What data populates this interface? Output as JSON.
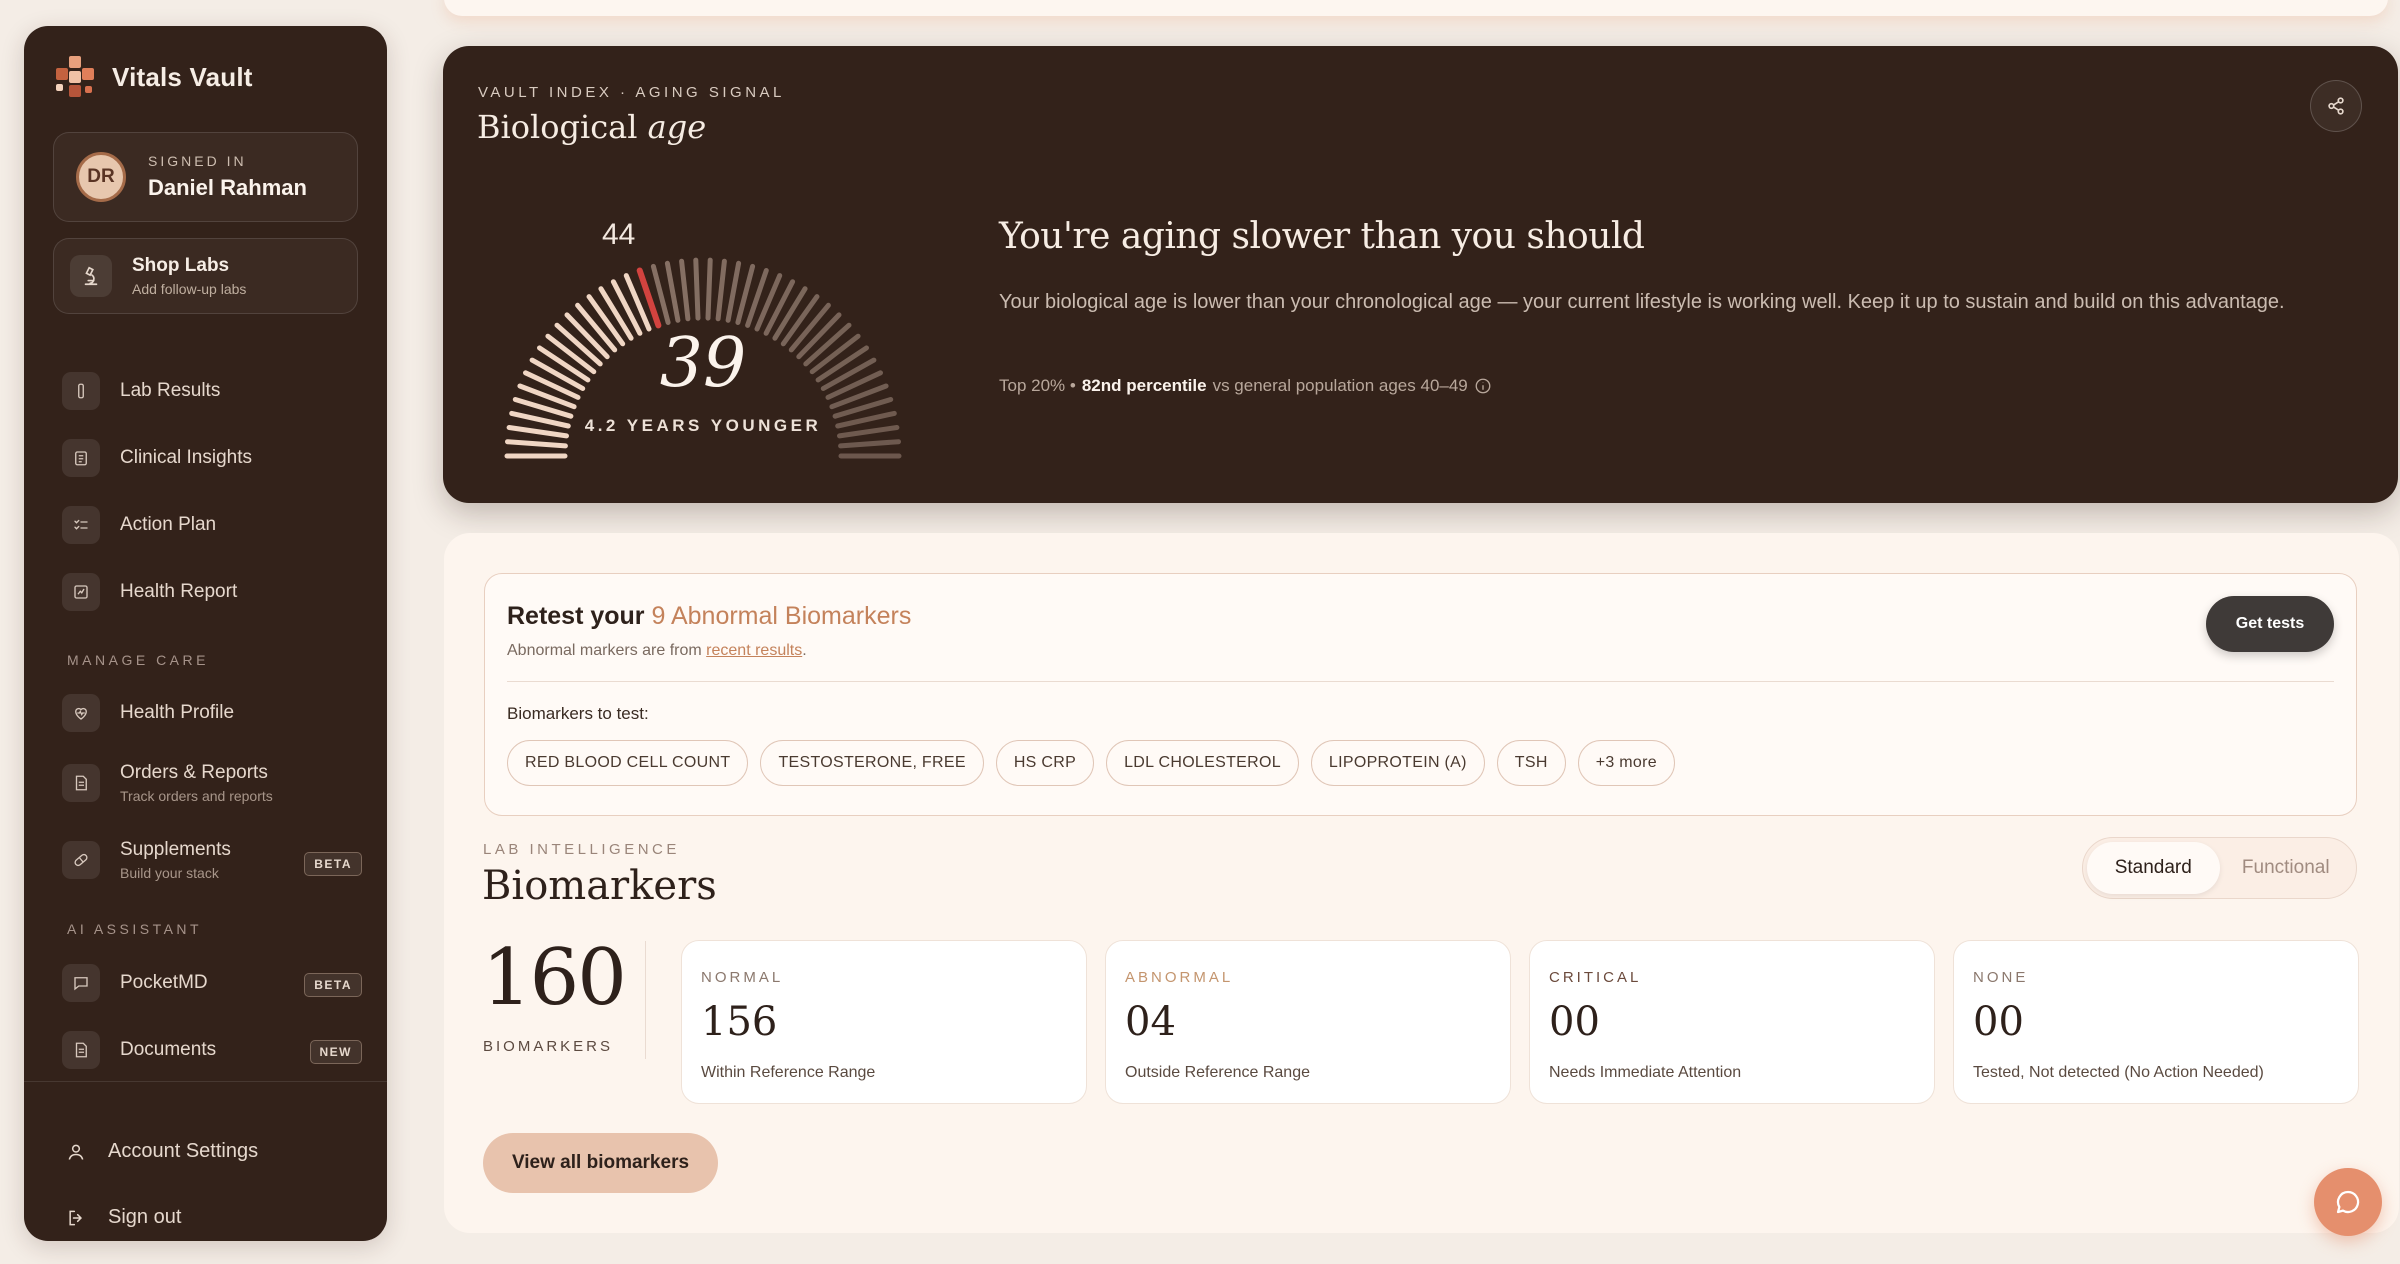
{
  "app": {
    "name": "Vitals Vault"
  },
  "user": {
    "signed_in_caption": "SIGNED IN",
    "name": "Daniel Rahman",
    "initials": "DR"
  },
  "shop": {
    "title": "Shop Labs",
    "subtitle": "Add follow-up labs"
  },
  "nav": {
    "main": [
      {
        "label": "Lab Results",
        "icon": "flask-icon"
      },
      {
        "label": "Clinical Insights",
        "icon": "clipboard-icon"
      },
      {
        "label": "Action Plan",
        "icon": "checklist-icon"
      },
      {
        "label": "Health Report",
        "icon": "chart-icon"
      }
    ],
    "manage_care_label": "MANAGE CARE",
    "manage_care": [
      {
        "label": "Health Profile",
        "icon": "heart-icon"
      },
      {
        "label": "Orders & Reports",
        "sub": "Track orders and reports",
        "icon": "document-icon"
      },
      {
        "label": "Supplements",
        "sub": "Build your stack",
        "badge": "BETA",
        "icon": "pill-icon"
      }
    ],
    "ai_label": "AI ASSISTANT",
    "ai": [
      {
        "label": "PocketMD",
        "badge": "BETA",
        "icon": "chat-icon"
      },
      {
        "label": "Documents",
        "badge": "NEW",
        "icon": "document-icon"
      }
    ],
    "bottom": [
      {
        "label": "Account Settings",
        "icon": "user-icon"
      },
      {
        "label": "Sign out",
        "icon": "sign-out-icon"
      }
    ]
  },
  "bio_age": {
    "eyebrow": "VAULT INDEX · AGING SIGNAL",
    "title_plain": "Biological ",
    "title_italic": "age",
    "chronological_age": "44",
    "biological_age": "39",
    "years_younger_label": "4.2 YEARS YOUNGER",
    "gauge_min": 20,
    "gauge_max": 80,
    "headline": "You're aging slower than you should",
    "description": "Your biological age is lower than your chronological age — your current lifestyle is working well. Keep it up to sustain and build on this advantage.",
    "percentile_prefix": "Top 20% •",
    "percentile_bold": "82nd percentile",
    "percentile_suffix": "vs general population ages 40–49"
  },
  "retest": {
    "heading_prefix": "Retest your",
    "heading_highlight": "9 Abnormal Biomarkers",
    "subtitle_prefix": "Abnormal markers are from",
    "subtitle_link": "recent results",
    "subtitle_suffix": ".",
    "get_tests_label": "Get tests",
    "biomarkers_label": "Biomarkers to test:",
    "chips": [
      "RED BLOOD CELL COUNT",
      "TESTOSTERONE, FREE",
      "HS CRP",
      "LDL CHOLESTEROL",
      "LIPOPROTEIN (A)",
      "TSH",
      "+3 more"
    ]
  },
  "biomarkers": {
    "eyebrow": "LAB INTELLIGENCE",
    "title": "Biomarkers",
    "toggle": {
      "options": [
        "Standard",
        "Functional"
      ],
      "active": "Standard"
    },
    "total": "160",
    "total_label": "BIOMARKERS",
    "stats": [
      {
        "caption": "NORMAL",
        "value": "156",
        "desc": "Within Reference Range",
        "color": "#8b786d"
      },
      {
        "caption": "ABNORMAL",
        "value": "04",
        "desc": "Outside Reference Range",
        "color": "#c4956e"
      },
      {
        "caption": "CRITICAL",
        "value": "00",
        "desc": "Needs Immediate Attention",
        "color": "#6b4a3c"
      },
      {
        "caption": "NONE",
        "value": "00",
        "desc": "Tested, Not detected (No Action Needed)",
        "color": "#8b786d"
      }
    ],
    "view_all_label": "View all biomarkers"
  },
  "colors": {
    "accent": "#c4825b",
    "sidebar_bg": "#33221a",
    "gauge_marker": "#d2433f",
    "chat_fab": "#e58f6d"
  }
}
